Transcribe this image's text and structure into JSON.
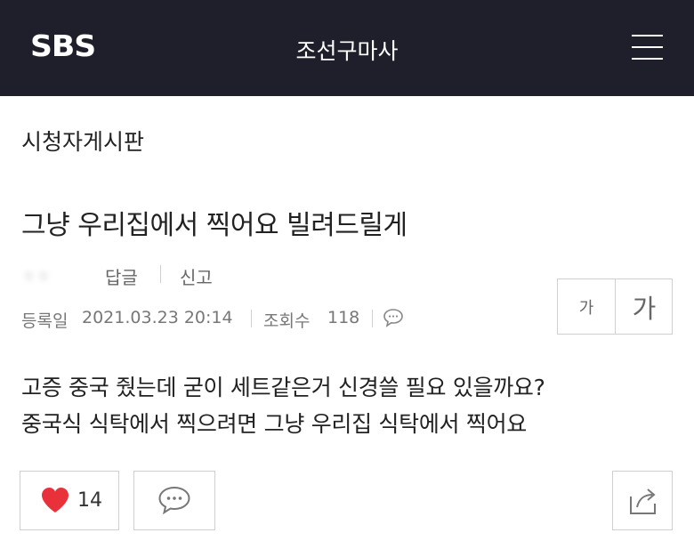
{
  "header": {
    "logo": "SBS",
    "title": "조선구마사",
    "menu_icon": "hamburger-menu-icon",
    "background_color": "#1f1f2b"
  },
  "board": {
    "name": "시청자게시판"
  },
  "post": {
    "title": "그냥 우리집에서 찍어요 빌려드릴게",
    "author": "ㅎㅎ",
    "reply_label": "답글",
    "report_label": "신고",
    "registered_label": "등록일",
    "registered_date": "2021.03.23 20:14",
    "views_label": "조회수",
    "views": "118",
    "comment_icon": "speech-bubble-icon",
    "body": [
      "고증 중국 줬는데 굳이 세트같은거 신경쓸 필요 있을까요?",
      "중국식 식탁에서 찍으려면 그냥 우리집 식탁에서 찍어요"
    ]
  },
  "font_size_controls": {
    "small_label": "가",
    "large_label": "가"
  },
  "actions": {
    "like_icon": "heart-icon",
    "like_count": "14",
    "like_color": "#e8313a",
    "comment_icon": "speech-bubble-icon",
    "share_icon": "share-icon"
  }
}
